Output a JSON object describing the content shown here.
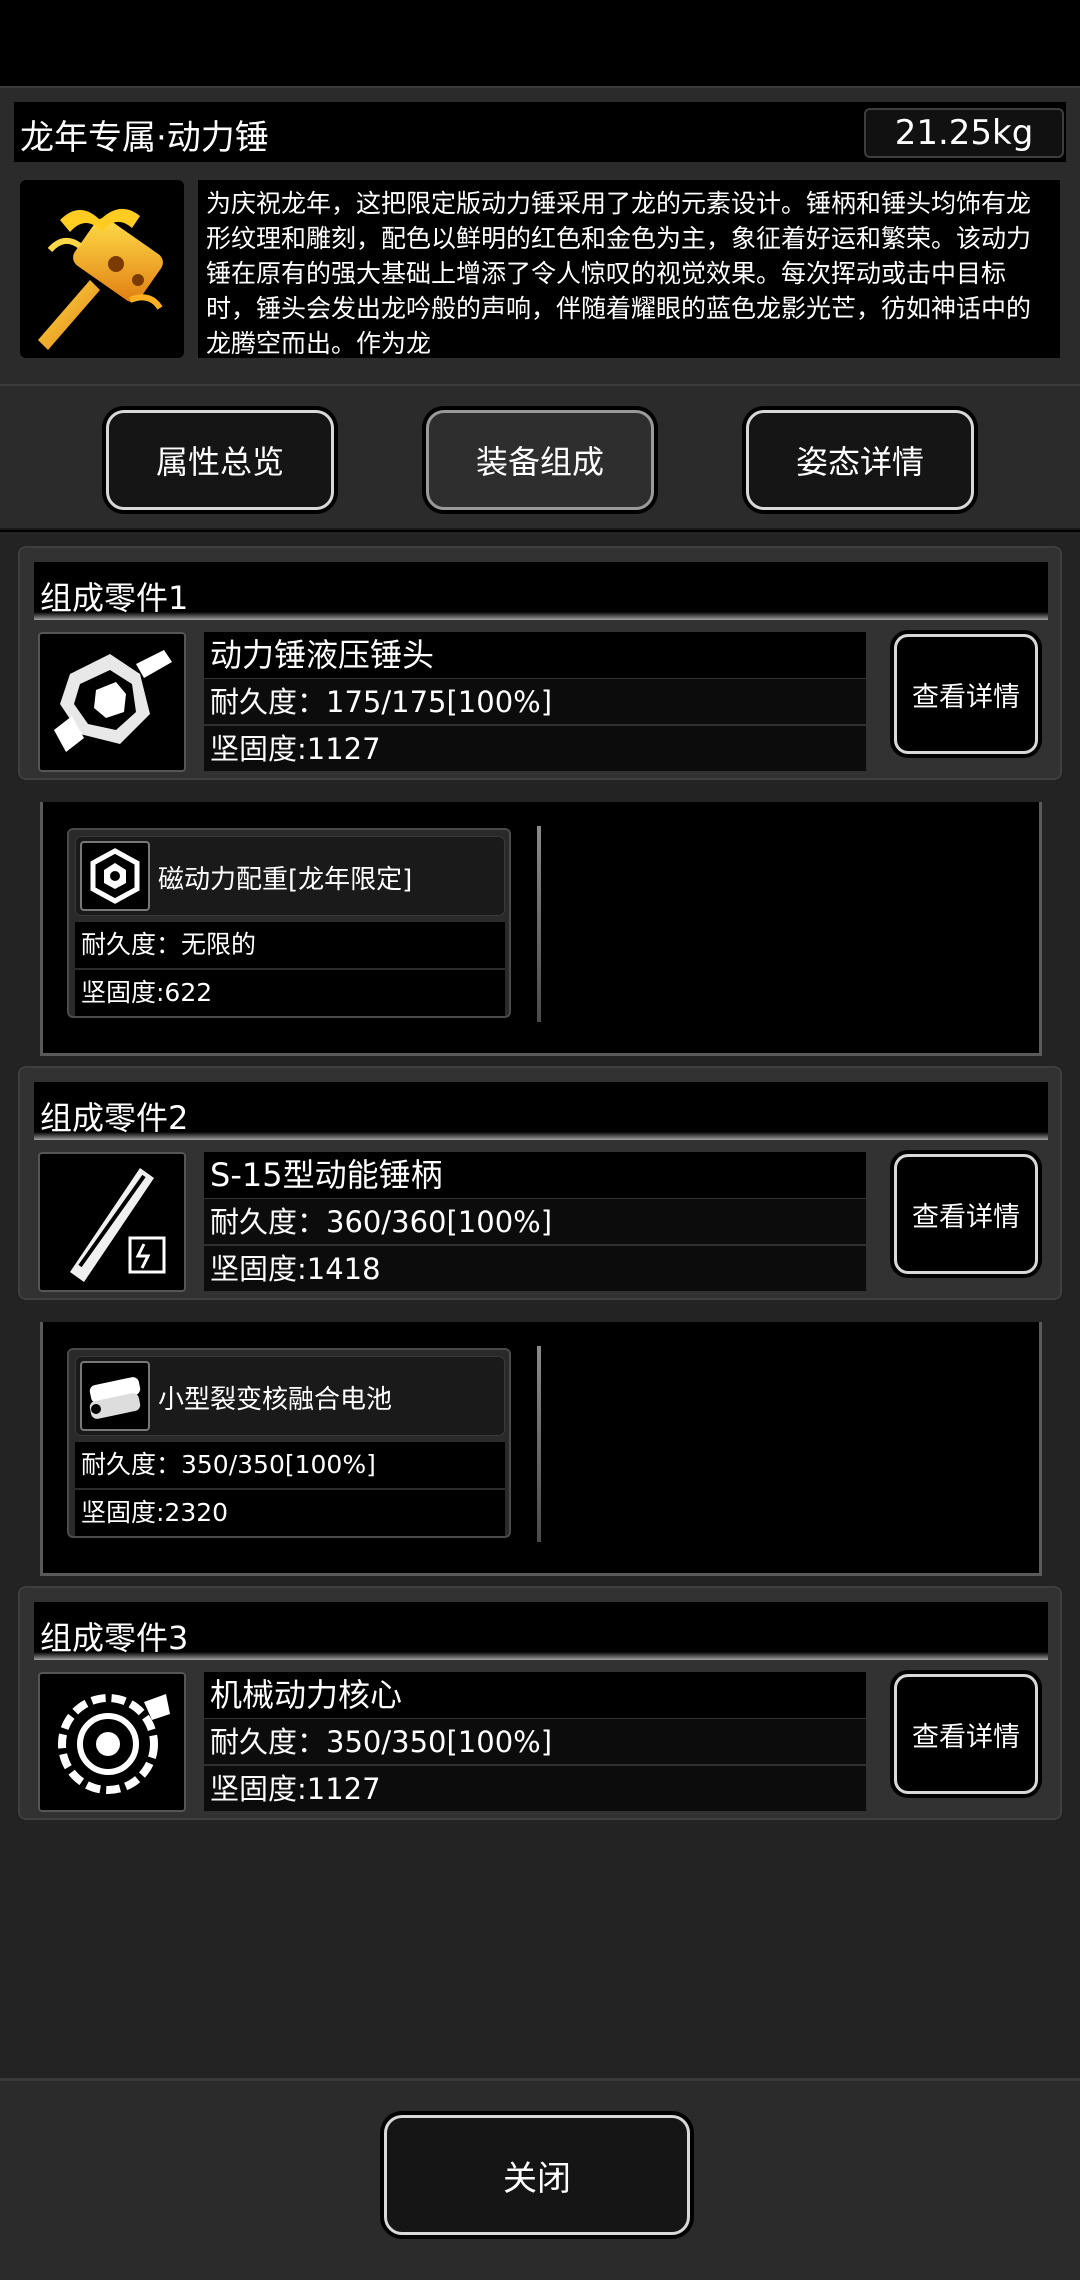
{
  "header": {
    "title": "龙年专属·动力锤",
    "weight": "21.25kg",
    "icon": "golden-dragon-hammer-icon",
    "description": "为庆祝龙年，这把限定版动力锤采用了龙的元素设计。锤柄和锤头均饰有龙形纹理和雕刻，配色以鲜明的红色和金色为主，象征着好运和繁荣。该动力锤在原有的强大基础上增添了令人惊叹的视觉效果。每次挥动或击中目标时，锤头会发出龙吟般的声响，伴随着耀眼的蓝色龙影光芒，彷如神话中的龙腾空而出。作为龙"
  },
  "tabs": [
    {
      "label": "属性总览",
      "active": false
    },
    {
      "label": "装备组成",
      "active": true
    },
    {
      "label": "姿态详情",
      "active": false
    }
  ],
  "parts": [
    {
      "header": "组成零件1",
      "name": "动力锤液压锤头",
      "durability": "耐久度：175/175[100%]",
      "toughness": "坚固度:1127",
      "icon": "hydraulic-hammer-head-icon",
      "detail_label": "查看详情",
      "sub": {
        "name": "磁动力配重[龙年限定]",
        "durability": "耐久度：无限的",
        "toughness": "坚固度:622",
        "icon": "hex-counterweight-icon"
      }
    },
    {
      "header": "组成零件2",
      "name": "S-15型动能锤柄",
      "durability": "耐久度：360/360[100%]",
      "toughness": "坚固度:1418",
      "icon": "kinetic-hammer-handle-icon",
      "detail_label": "查看详情",
      "sub": {
        "name": "小型裂变核融合电池",
        "durability": "耐久度：350/350[100%]",
        "toughness": "坚固度:2320",
        "icon": "fusion-battery-icon"
      }
    },
    {
      "header": "组成零件3",
      "name": "机械动力核心",
      "durability": "耐久度：350/350[100%]",
      "toughness": "坚固度:1127",
      "icon": "mechanical-power-core-icon",
      "detail_label": "查看详情"
    }
  ],
  "footer": {
    "close_label": "关闭"
  }
}
